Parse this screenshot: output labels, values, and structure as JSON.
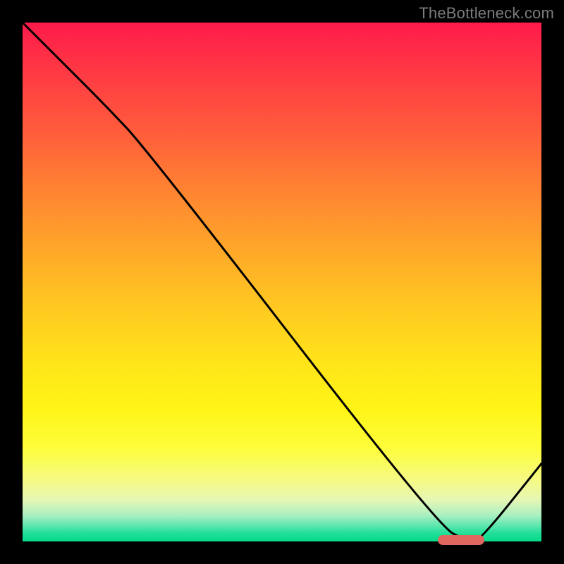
{
  "watermark": "TheBottleneck.com",
  "colors": {
    "marker": "#e0675f",
    "curve": "#000000",
    "frame": "#000000"
  },
  "chart_data": {
    "type": "line",
    "title": "",
    "xlabel": "",
    "ylabel": "",
    "ylim": [
      0,
      100
    ],
    "xlim": [
      0,
      100
    ],
    "x": [
      0,
      8,
      16,
      24,
      80,
      86,
      88,
      100
    ],
    "values": [
      100,
      92,
      84,
      75.5,
      3,
      0,
      0,
      15
    ],
    "marker": {
      "x_start": 80,
      "x_end": 89,
      "y": 0
    },
    "note": "Values estimated from pixel positions; curve starts at top-left, near-linear drop to x≈24, steeper linear segment to minimum near x≈83–88, then rises toward right edge."
  }
}
